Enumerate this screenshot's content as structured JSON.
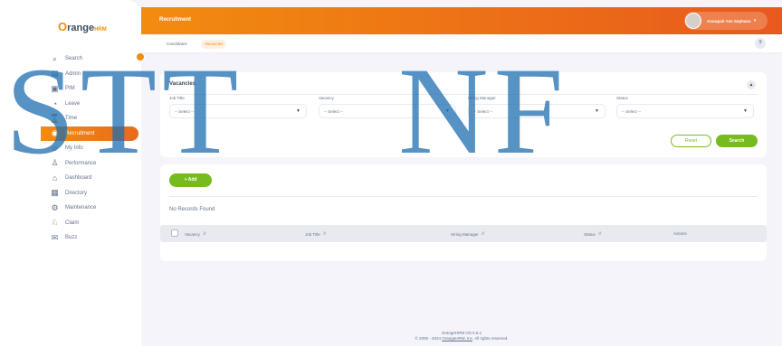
{
  "logo": {
    "o": "O",
    "text": "range",
    "hrm": "HRM"
  },
  "sidebar": {
    "items": [
      {
        "label": "Search",
        "icon": "search-icon",
        "glyph": "⌕"
      },
      {
        "label": "Admin",
        "icon": "admin-icon",
        "glyph": "▤"
      },
      {
        "label": "PIM",
        "icon": "pim-icon",
        "glyph": "▣"
      },
      {
        "label": "Leave",
        "icon": "leave-icon",
        "glyph": "◔"
      },
      {
        "label": "Time",
        "icon": "time-icon",
        "glyph": "⌛"
      },
      {
        "label": "Recruitment",
        "icon": "recruitment-icon",
        "glyph": "◉"
      },
      {
        "label": "My Info",
        "icon": "myinfo-icon",
        "glyph": "☺"
      },
      {
        "label": "Performance",
        "icon": "performance-icon",
        "glyph": "♙"
      },
      {
        "label": "Dashboard",
        "icon": "dashboard-icon",
        "glyph": "⌂"
      },
      {
        "label": "Directory",
        "icon": "directory-icon",
        "glyph": "▦"
      },
      {
        "label": "Maintenance",
        "icon": "maintenance-icon",
        "glyph": "⚙"
      },
      {
        "label": "Claim",
        "icon": "claim-icon",
        "glyph": "♘"
      },
      {
        "label": "Buzz",
        "icon": "buzz-icon",
        "glyph": "✉"
      }
    ]
  },
  "header": {
    "title": "Recruitment",
    "user_name": "Anoopah Yan Sephans",
    "caret": "▾"
  },
  "tabs": {
    "candidates": "Candidates",
    "vacancies": "Vacancies"
  },
  "help": "?",
  "filter": {
    "title": "Vacancies",
    "toggle": "▲",
    "fields": [
      {
        "label": "Job Title",
        "value": "-- Select --"
      },
      {
        "label": "Vacancy",
        "value": "-- Select --"
      },
      {
        "label": "Hiring Manager",
        "value": "-- Select --"
      },
      {
        "label": "Status",
        "value": "-- Select --"
      }
    ],
    "caret": "▼",
    "reset_label": "Reset",
    "search_label": "Search"
  },
  "list": {
    "add_label": "+ Add",
    "records_text": "No Records Found",
    "columns": [
      "Vacancy",
      "Job Title",
      "Hiring Manager",
      "Status",
      "Actions"
    ],
    "sort_glyph": "⇵"
  },
  "footer": {
    "version": "OrangeHRM OS 5.6.1",
    "copyright_prefix": "© 2005 - 2024 ",
    "company": "OrangeHRM, Inc",
    "copyright_suffix": ". All rights reserved."
  },
  "watermark": {
    "left": "STT",
    "right": "NF"
  },
  "colors": {
    "accent": "#f28c0f",
    "green": "#76bc21",
    "watermark": "#1e6eaf"
  }
}
